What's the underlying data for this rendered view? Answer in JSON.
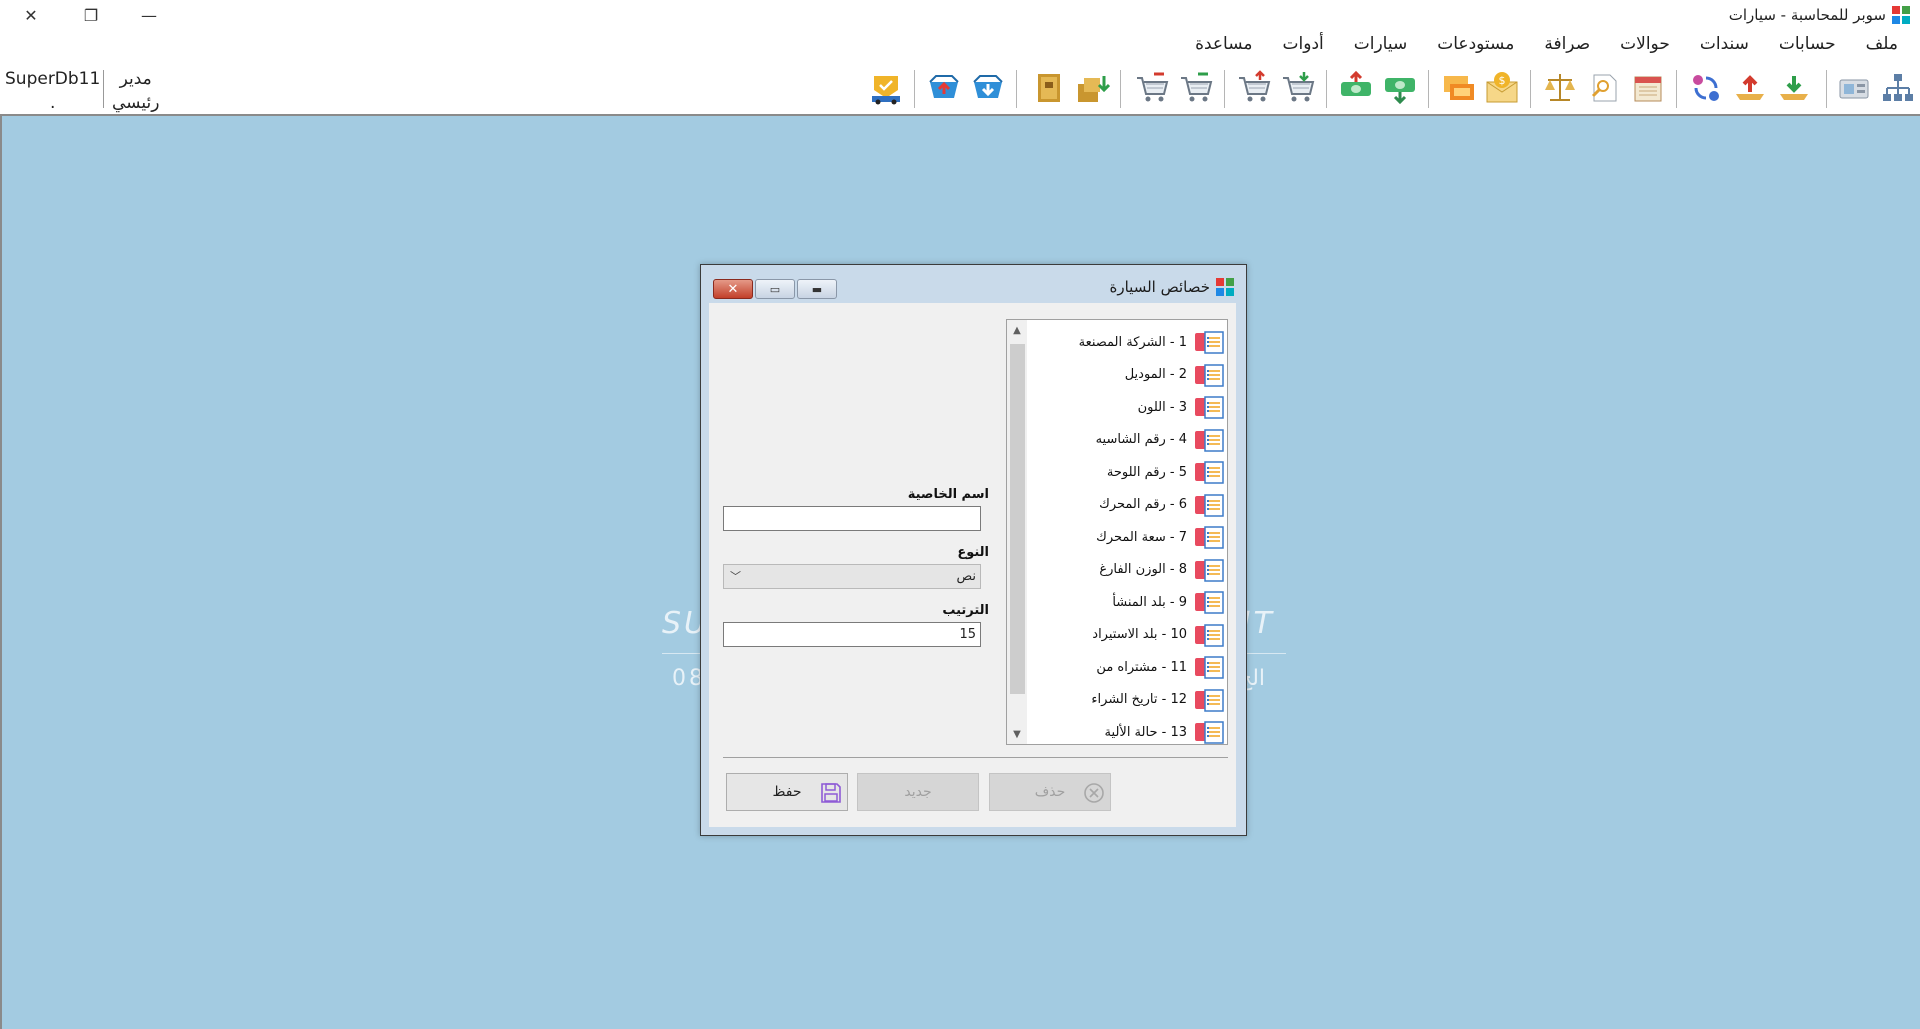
{
  "app": {
    "title": "سوبر للمحاسبة - سيارات",
    "window_controls": {
      "close": "✕",
      "restore": "❐",
      "minimize": "—"
    }
  },
  "menu": [
    "ملف",
    "حسابات",
    "سندات",
    "حوالات",
    "صرافة",
    "مستودعات",
    "سيارات",
    "أدوات",
    "مساعدة"
  ],
  "toolbar": {
    "user": {
      "db": "SuperDb11",
      "db_sub": ".",
      "role": "مدير",
      "role_sub": "رئيسي"
    },
    "icons": [
      "accounts-tree-icon",
      "cash-register-icon",
      "receipt-voucher-icon",
      "payment-voucher-icon",
      "transfer-icon",
      "journal-icon",
      "calendar-icon",
      "search-document-icon",
      "balance-scale-icon",
      "currency-exchange-icon",
      "money-transfer-icon",
      "cash-out-icon",
      "cash-in-icon",
      "purchase-cart-icon",
      "sales-cart-icon",
      "purchase-return-icon",
      "sales-return-icon",
      "stock-in-icon",
      "stock-out-icon",
      "cart-down-icon",
      "cart-up-icon",
      "car-insurance-icon"
    ]
  },
  "background": {
    "left_text": "SU",
    "right_text": "NT",
    "left_sub": "08",
    "right_sub": "الج"
  },
  "dialog": {
    "title": "خصائص السيارة",
    "list": [
      "1 - الشركة المصنعة",
      "2 - الموديل",
      "3 - اللون",
      "4 - رقم الشاسيه",
      "5 - رقم اللوحة",
      "6 - رقم المحرك",
      "7 - سعة المحرك",
      "8 - الوزن الفارغ",
      "9 - بلد المنشأ",
      "10 - بلد الاستيراد",
      "11 - مشتراه من",
      "12 - تاريخ الشراء",
      "13 - حالة الألية"
    ],
    "form": {
      "name_label": "اسم الخاصية",
      "name_value": "",
      "type_label": "النوع",
      "type_value": "نص",
      "order_label": "الترتيب",
      "order_value": "15"
    },
    "buttons": {
      "save": "حفظ",
      "new": "جديد",
      "delete": "حذف"
    }
  },
  "colors": {
    "workspace": "#a3cbe1",
    "dialog_frame": "#c9daea",
    "close_button": "#c2402a"
  }
}
